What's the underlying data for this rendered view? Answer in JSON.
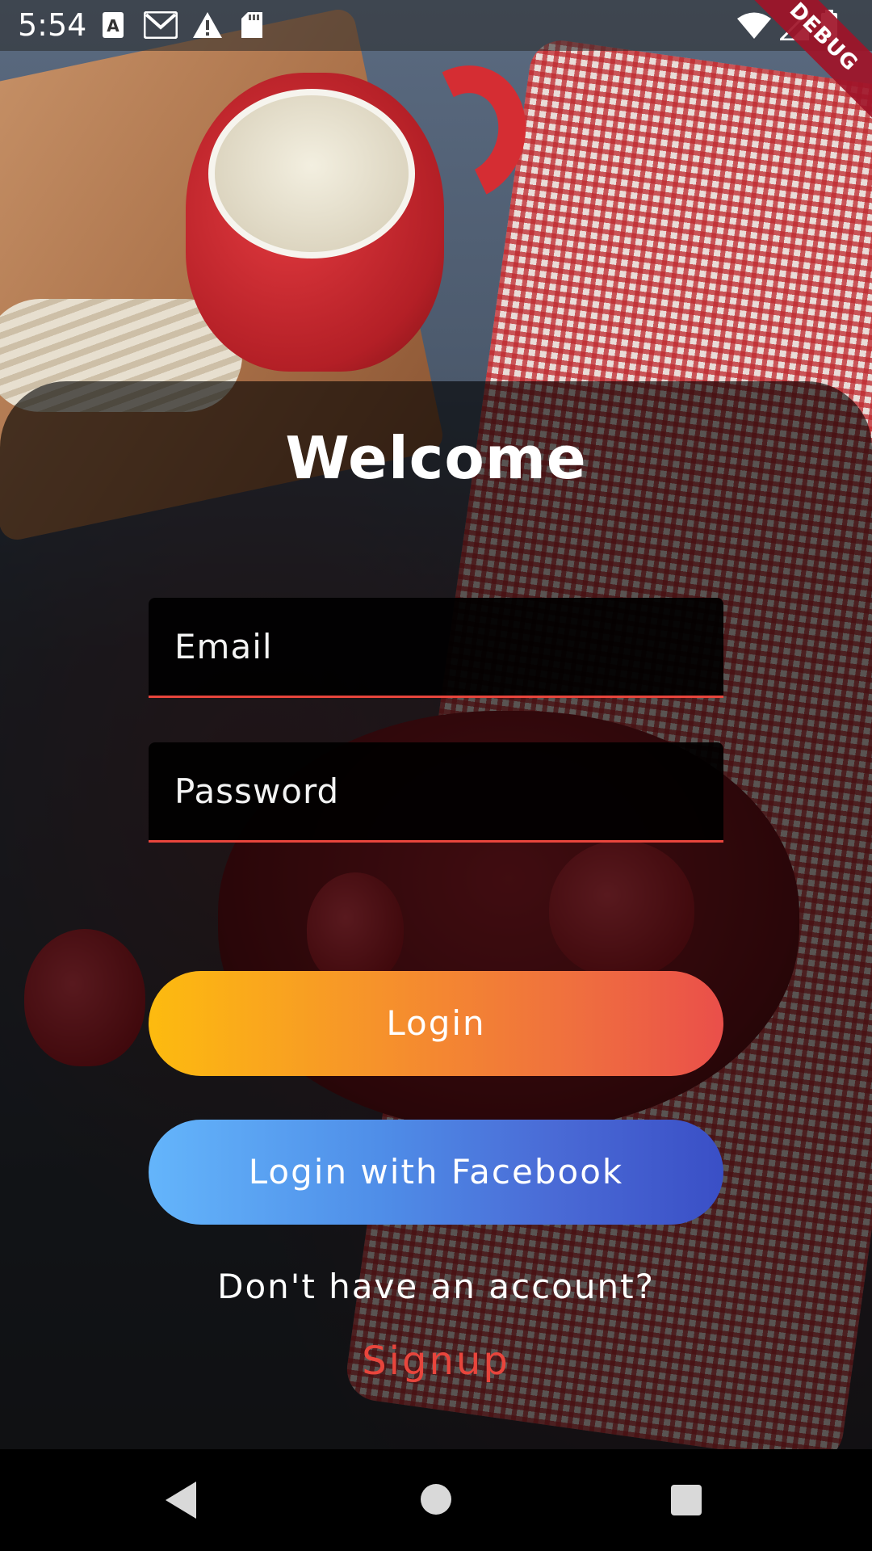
{
  "status_bar": {
    "time": "5:54",
    "left_icons": [
      "font-download-icon",
      "gmail-icon",
      "warning-icon",
      "sd-card-icon"
    ],
    "right_icons": [
      "wifi-icon",
      "cell-signal-icon",
      "battery-icon"
    ]
  },
  "debug_banner": "DEBUG",
  "login": {
    "title": "Welcome",
    "email_placeholder": "Email",
    "password_placeholder": "Password",
    "login_button": "Login",
    "facebook_button": "Login with Facebook",
    "signup_prompt": "Don't have an account?",
    "signup_link": "Signup"
  },
  "colors": {
    "accent": "#e8453c",
    "login_gradient": [
      "#fdbb0f",
      "#ea4f4a"
    ],
    "facebook_gradient": [
      "#64b5fb",
      "#3a4fc6"
    ]
  },
  "nav_bar": {
    "buttons": [
      "back-icon",
      "home-icon",
      "recents-icon"
    ]
  }
}
